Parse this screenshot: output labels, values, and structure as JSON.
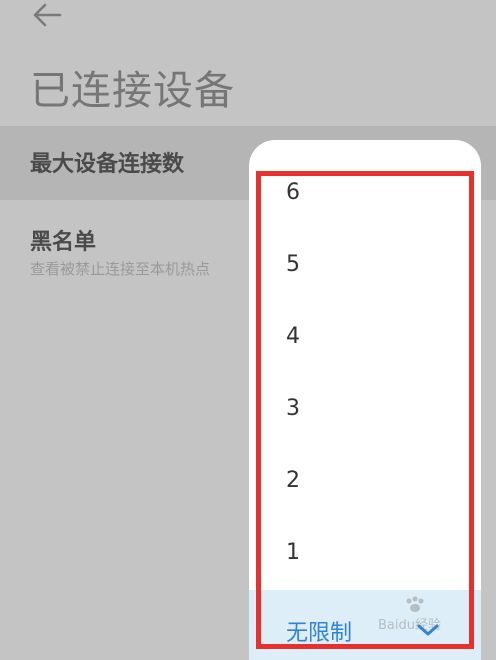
{
  "header": {
    "back_icon": "arrow-left-icon",
    "title": "已连接设备"
  },
  "settings": {
    "max_connections_label": "最大设备连接数",
    "blacklist_label": "黑名单",
    "blacklist_description": "查看被禁止连接至本机热点"
  },
  "picker": {
    "options": [
      "6",
      "5",
      "4",
      "3",
      "2",
      "1"
    ],
    "selected_label": "无限制",
    "selected_icon": "checkmark-icon",
    "accent_color": "#2f83d8",
    "highlight_color": "#e8302d"
  },
  "watermark": {
    "text": "Baidu经验"
  }
}
